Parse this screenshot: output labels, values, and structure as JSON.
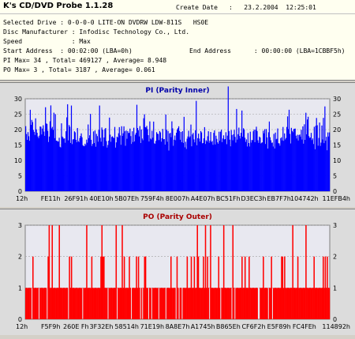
{
  "header": {
    "app_title": "K's CD/DVD Probe 1.1.28",
    "create_date_label": "Create Date",
    "create_date_value": ":   23.2.2004  12:25:01",
    "lines": [
      "Selected Drive : 0-0-0-0 LITE-ON DVDRW LDW-811S   HS0E",
      "Disc Manufacturer : Infodisc Technology Co., Ltd.",
      "Speed             : Max"
    ],
    "start_address": "Start Address  : 00:02:00 (LBA=0h)",
    "end_address": "End Address      : 00:00:00 (LBA=1CBBF5h)",
    "pi_summary": "PI Max= 34 , Total= 469127 , Average= 8.948",
    "po_summary": "PO Max= 3 , Total= 3187 , Average= 0.061"
  },
  "colors": {
    "pi_bar": "#0000ff",
    "po_bar": "#ff0000",
    "chart_bg": "#dcdcdc",
    "title_blue": "#0000aa",
    "title_red": "#aa0000"
  },
  "chart_data": [
    {
      "type": "bar",
      "title": "PI (Parity Inner)",
      "ylim": [
        0,
        30
      ],
      "y_ticks": [
        0,
        5,
        10,
        15,
        20,
        25,
        30
      ],
      "x_ticks": [
        "12h",
        "FE11h",
        "26F91h",
        "40E10h",
        "5B07Eh",
        "759F4h",
        "8E007h",
        "A4E07h",
        "BC51Fh",
        "D3EC3h",
        "EB7F7h",
        "104742h",
        "11EFB4h"
      ],
      "max": 34,
      "average": 8.948,
      "grid": "dashed"
    },
    {
      "type": "bar",
      "title": "PO (Parity Outer)",
      "ylim": [
        0,
        3
      ],
      "y_ticks": [
        0,
        1,
        2,
        3
      ],
      "x_ticks": [
        "12h",
        "F5F9h",
        "260E Fh",
        "3F32Eh",
        "58514h",
        "71E19h",
        "8A8E7h",
        "A1745h",
        "B865Eh",
        "CF6F2h",
        "E5F89h",
        "FC4FEh",
        "114892h"
      ],
      "max": 3,
      "average": 0.061,
      "grid": "dashed"
    }
  ]
}
